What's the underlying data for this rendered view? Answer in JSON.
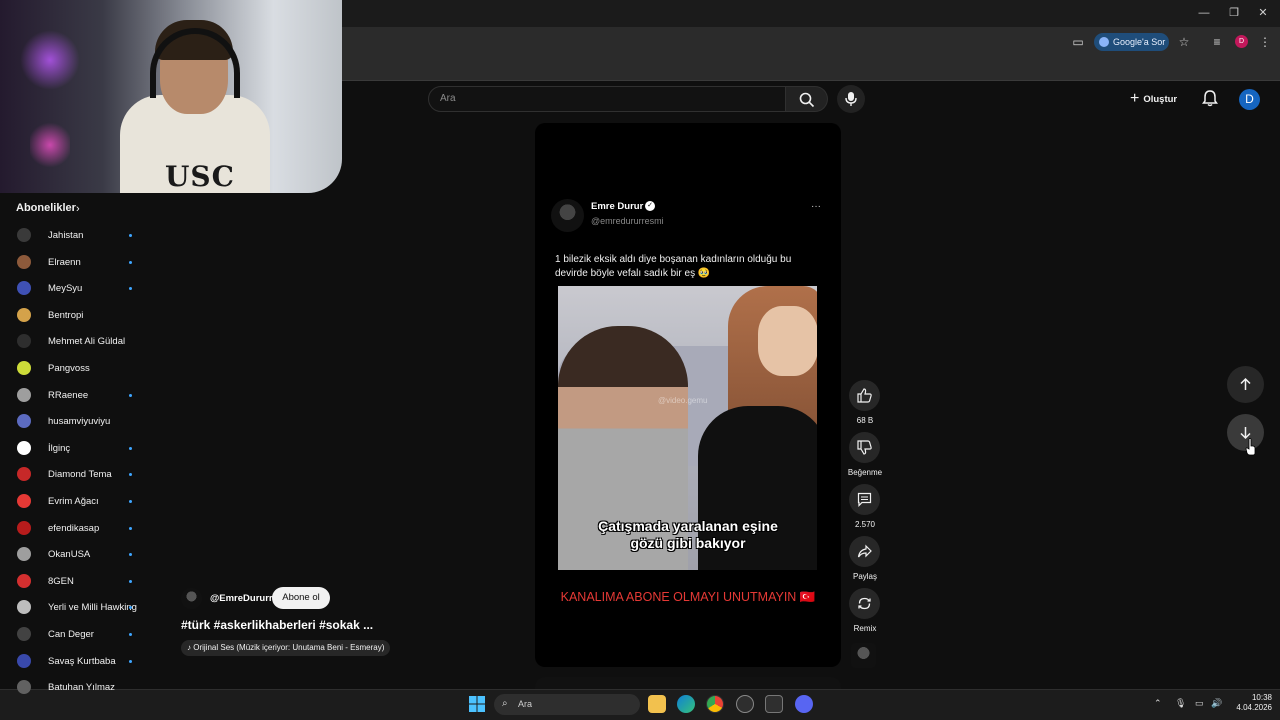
{
  "browser": {
    "google_ask_label": "Google'a Sor",
    "profile_initial": "D"
  },
  "header": {
    "search_placeholder": "Ara",
    "create_label": "Oluştur",
    "avatar_initial": "D"
  },
  "sidebar": {
    "title": "Abonelikler",
    "items": [
      {
        "label": "Jahistan",
        "dot": true,
        "color": "#3a3a3a"
      },
      {
        "label": "Elraenn",
        "dot": true,
        "color": "#8d5a3b"
      },
      {
        "label": "MeySyu",
        "dot": true,
        "color": "#3f51b5"
      },
      {
        "label": "Bentropi",
        "dot": false,
        "color": "#d4a24a"
      },
      {
        "label": "Mehmet Ali Güldal",
        "dot": false,
        "color": "#2e2e2e"
      },
      {
        "label": "Pangvoss",
        "dot": false,
        "color": "#cddc39"
      },
      {
        "label": "RRaenee",
        "dot": true,
        "color": "#9e9e9e"
      },
      {
        "label": "husamviyuviyu",
        "dot": false,
        "color": "#5c6bc0"
      },
      {
        "label": "İlginç",
        "dot": true,
        "color": "#ffffff"
      },
      {
        "label": "Diamond Tema",
        "dot": true,
        "color": "#c62828"
      },
      {
        "label": "Evrim Ağacı",
        "dot": true,
        "color": "#e53935"
      },
      {
        "label": "efendikasap",
        "dot": true,
        "color": "#b71c1c"
      },
      {
        "label": "OkanUSA",
        "dot": true,
        "color": "#9e9e9e"
      },
      {
        "label": "8GEN",
        "dot": true,
        "color": "#d32f2f"
      },
      {
        "label": "Yerli ve Milli Hawking",
        "dot": true,
        "color": "#bdbdbd"
      },
      {
        "label": "Can Deger",
        "dot": true,
        "color": "#424242"
      },
      {
        "label": "Savaş Kurtbaba",
        "dot": true,
        "color": "#3949ab"
      },
      {
        "label": "Batuhan Yılmaz",
        "dot": false,
        "color": "#616161"
      }
    ]
  },
  "short": {
    "tweet_name": "Emre Durur",
    "tweet_handle": "@emredururresmi",
    "tweet_text": "1 bilezik eksik aldı diye boşanan kadınların olduğu bu devirde böyle vefalı sadık bir eş 🥹",
    "video_caption": "Çatışmada yaralanan eşine gözü gibi bakıyor",
    "watermark": "@video.gemu",
    "promo_text": "KANALIMA ABONE OLMAYI UNUTMAYIN 🇹🇷",
    "channel_name": "@EmreDururr",
    "subscribe_label": "Abone ol",
    "title": "#türk #askerlikhaberleri #sokak ...",
    "music": "Orijinal Ses (Müzik içeriyor: Unutama Beni - Esmeray)"
  },
  "actions": {
    "like_count": "68 B",
    "dislike_label": "Beğenme",
    "comment_count": "2.570",
    "share_label": "Paylaş",
    "remix_label": "Remix"
  },
  "taskbar": {
    "search_label": "Ara",
    "time": "10:38",
    "date": "4.04.2026"
  }
}
